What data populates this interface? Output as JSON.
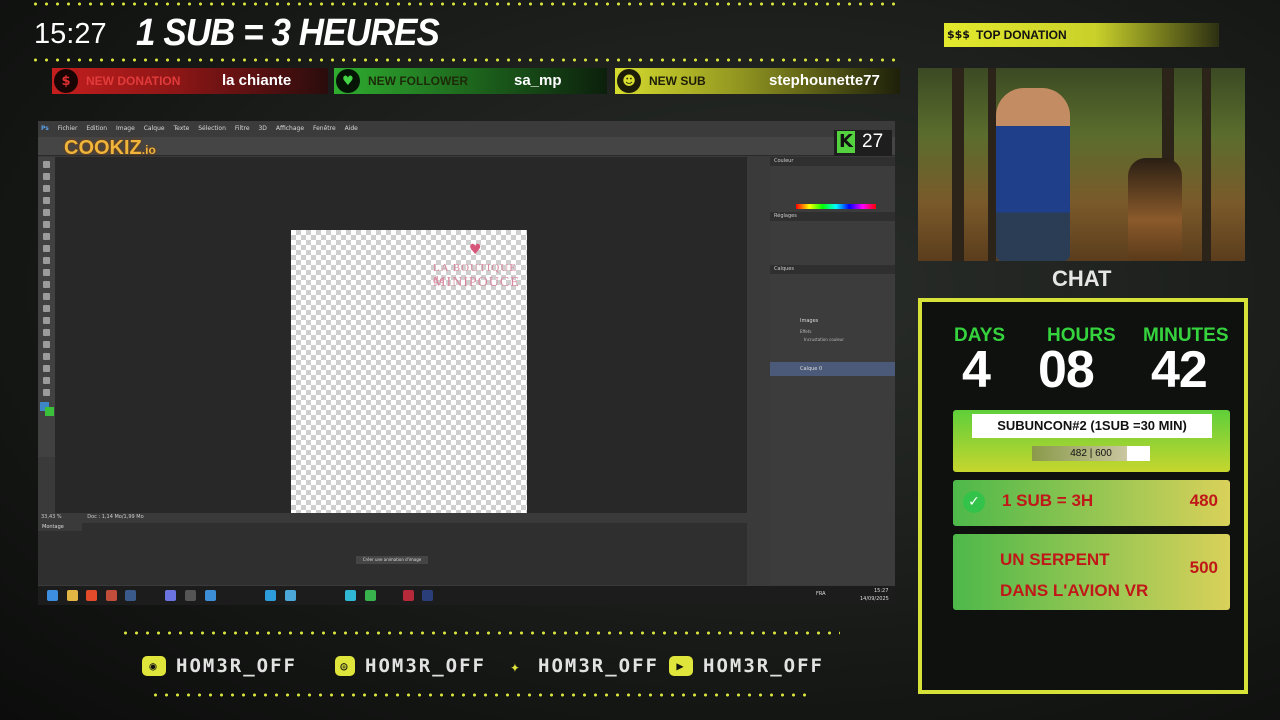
{
  "header": {
    "clock": "15:27",
    "headline": "1 SUB = 3 HEURES"
  },
  "alerts": [
    {
      "tag": "NEW DONATION",
      "value": "la chiante",
      "icon": "dollar-icon",
      "color": "#d42020"
    },
    {
      "tag": "NEW FOLLOWER",
      "value": "sa_mp",
      "icon": "heart-icon",
      "color": "#2fb52f"
    },
    {
      "tag": "NEW SUB",
      "value": "stephounette77",
      "icon": "users-icon",
      "color": "#d9df2f"
    }
  ],
  "top_donation": {
    "label": "TOP DONATION",
    "badge": "$$$"
  },
  "sponsor": {
    "logo_text": "COOKIZ",
    "logo_suffix": ".io",
    "counter_badge": "K",
    "counter_value": "27"
  },
  "photoshop": {
    "menu": [
      "Fichier",
      "Edition",
      "Image",
      "Calque",
      "Texte",
      "Sélection",
      "Filtre",
      "3D",
      "Affichage",
      "Fenêtre",
      "Aide"
    ],
    "doc_text": [
      "LA BOUTIQUE de",
      "MINIPOUCE"
    ],
    "status": "Doc : 1,14 Mo/1,99 Mo",
    "zoom": "33,43 %",
    "timeline_tab": "Montage",
    "timeline_button": "Créer une animation d'image",
    "layers": [
      "Images",
      "Effets",
      "Incrustation couleur",
      "Calque 0"
    ],
    "taskbar_time": "15:27",
    "taskbar_date": "14/09/2025",
    "taskbar_lang": "FRA"
  },
  "chat": {
    "title": "CHAT"
  },
  "subathon": {
    "labels": {
      "days": "DAYS",
      "hours": "HOURS",
      "minutes": "MINUTES"
    },
    "values": {
      "days": "4",
      "hours": "08",
      "minutes": "42"
    },
    "goal_title": "SUBUNCON#2 (1SUB =30 MIN)",
    "goal_progress_text": "482 | 600",
    "goal_progress": 0.803,
    "goals": [
      {
        "label": "1 SUB = 3H",
        "value": "480",
        "done": true
      },
      {
        "label": "UN SERPENT DANS L'AVION VR",
        "value": "500",
        "done": false
      }
    ]
  },
  "socials": [
    {
      "platform": "discord-icon",
      "handle": "HOM3R_OFF"
    },
    {
      "platform": "instagram-icon",
      "handle": "HOM3R_OFF"
    },
    {
      "platform": "twitter-icon",
      "handle": "HOM3R_OFF"
    },
    {
      "platform": "youtube-icon",
      "handle": "HOM3R_OFF"
    }
  ],
  "colors": {
    "accent": "#d9e53a",
    "green": "#35d43e",
    "red": "#d42020"
  }
}
